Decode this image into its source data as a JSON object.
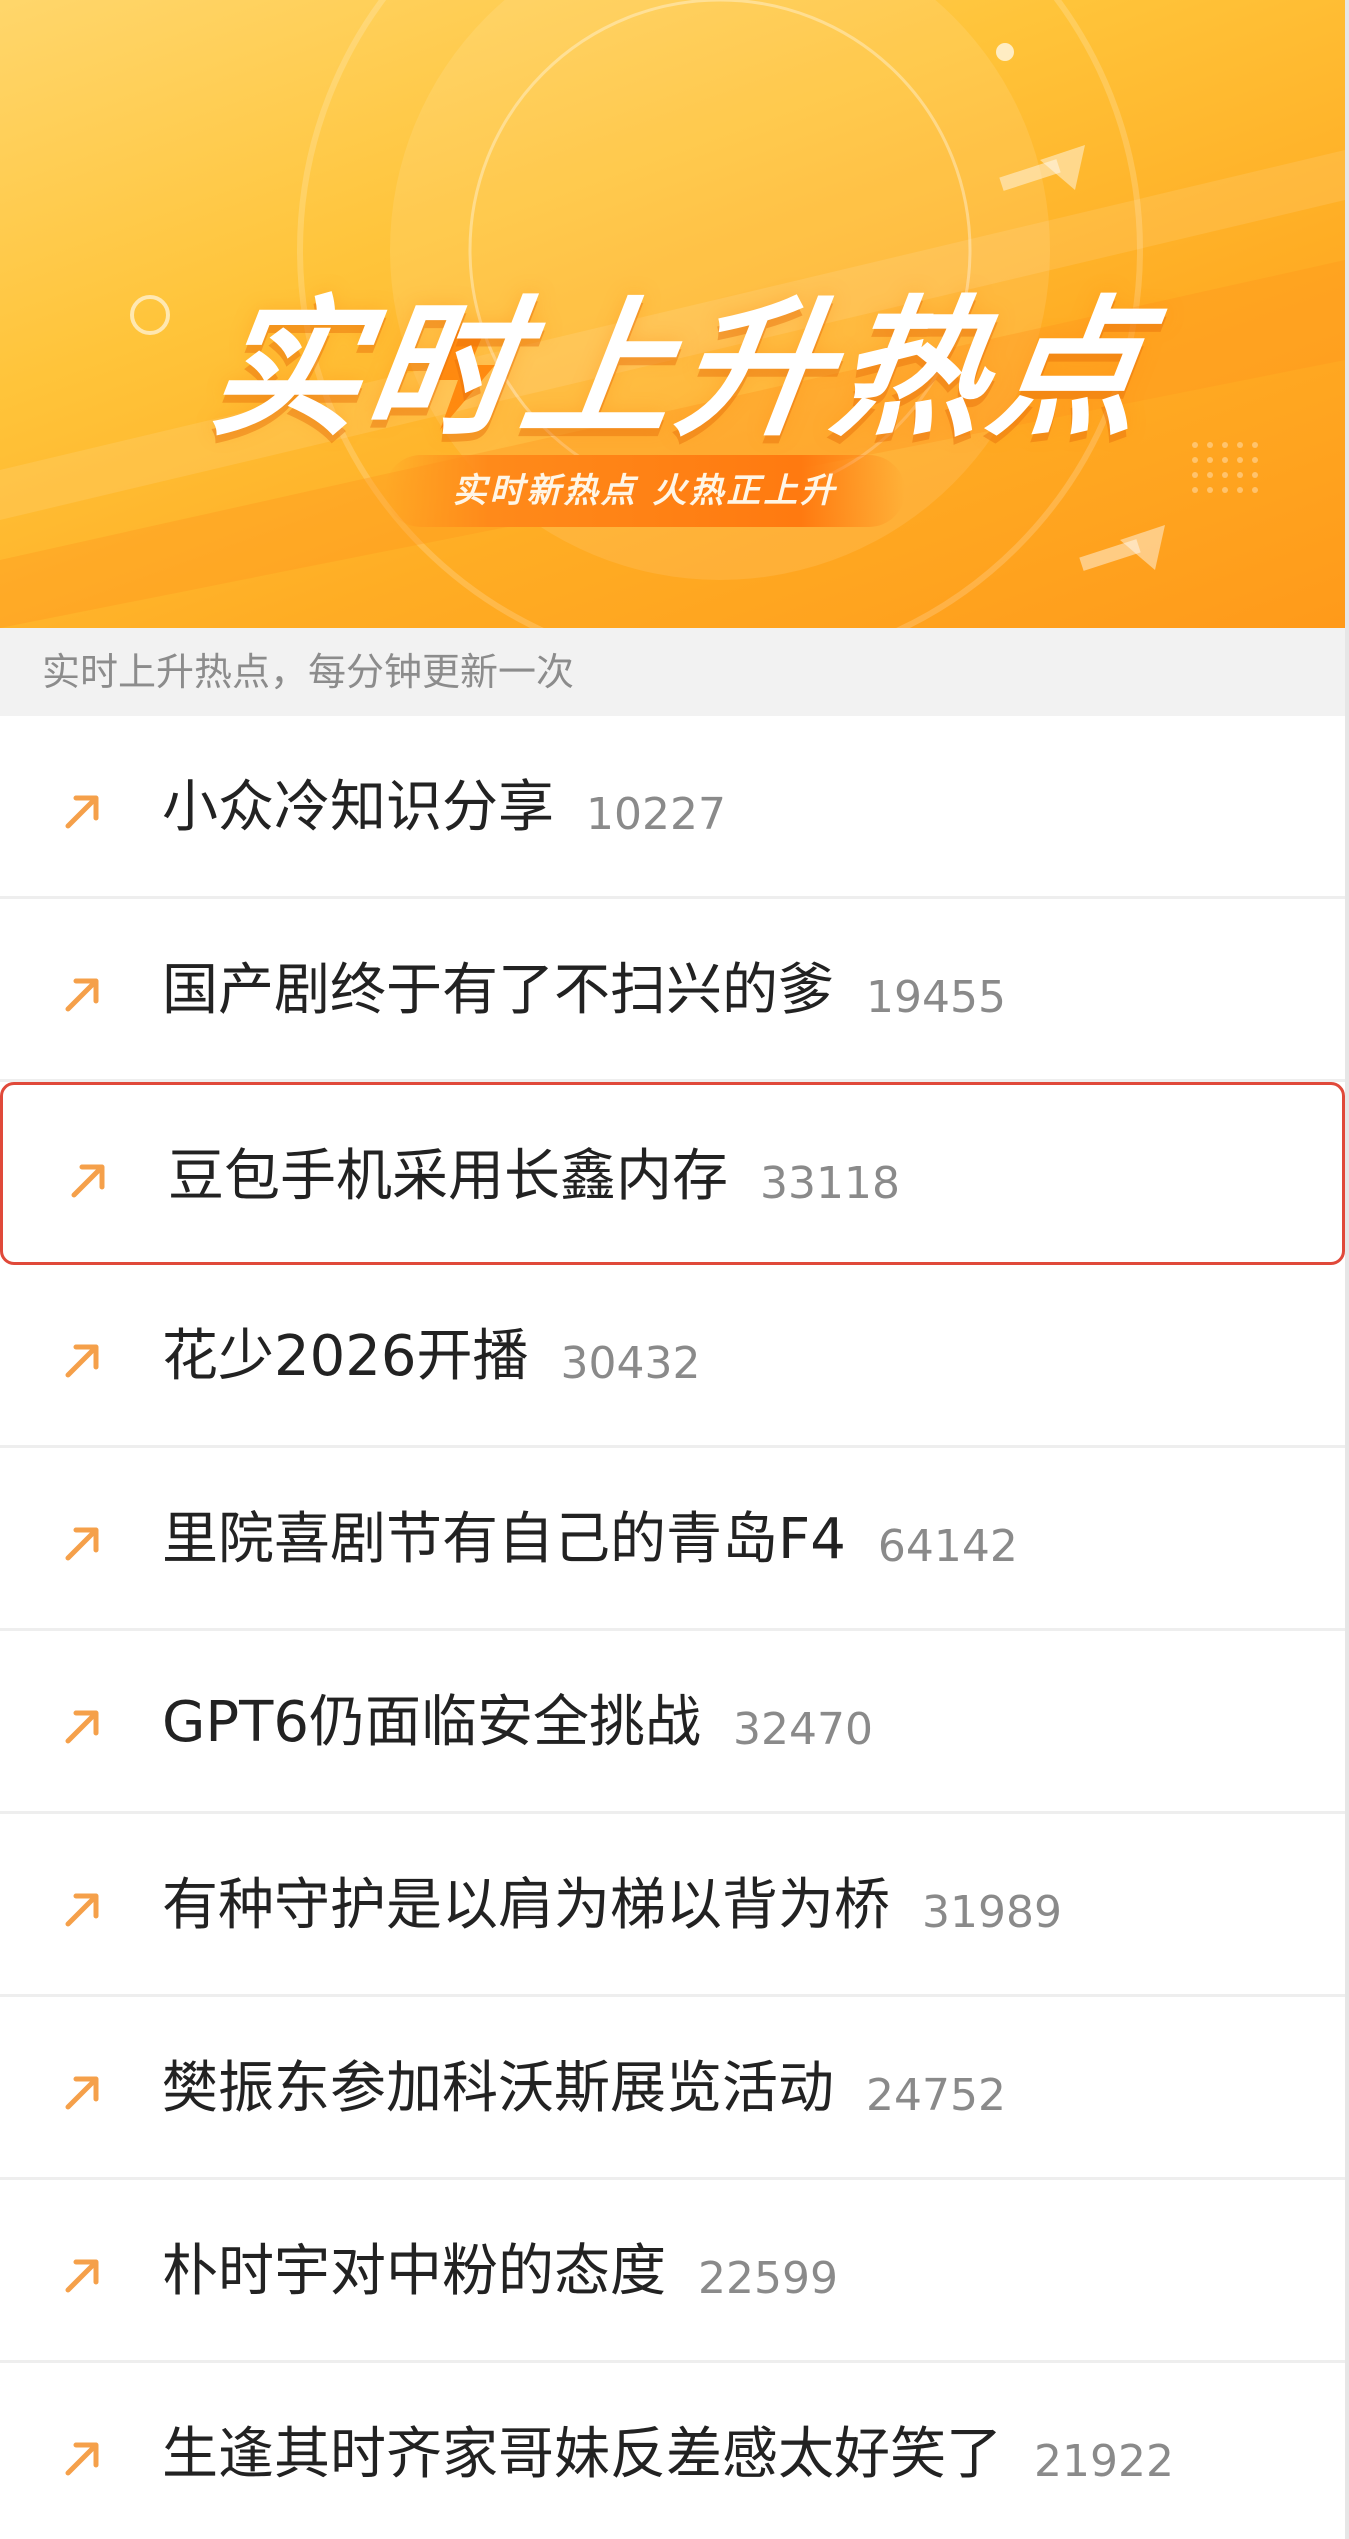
{
  "banner": {
    "title": "实时上升热点",
    "subtitle": "实时新热点 火热正上升"
  },
  "info": {
    "text": "实时上升热点，每分钟更新一次"
  },
  "colors": {
    "accent_orange": "#ff9a1a",
    "arrow": "#f5a04a",
    "highlight_border": "#e0493a"
  },
  "items": [
    {
      "title": "小众冷知识分享",
      "count": "10227",
      "icon": "trending-up-arrow-icon"
    },
    {
      "title": "国产剧终于有了不扫兴的爹",
      "count": "19455",
      "icon": "trending-up-arrow-icon"
    },
    {
      "title": "豆包手机采用长鑫内存",
      "count": "33118",
      "icon": "trending-up-arrow-icon",
      "highlighted": true
    },
    {
      "title": "花少2026开播",
      "count": "30432",
      "icon": "trending-up-arrow-icon"
    },
    {
      "title": "里院喜剧节有自己的青岛F4",
      "count": "64142",
      "icon": "trending-up-arrow-icon"
    },
    {
      "title": "GPT6仍面临安全挑战",
      "count": "32470",
      "icon": "trending-up-arrow-icon"
    },
    {
      "title": "有种守护是以肩为梯以背为桥",
      "count": "31989",
      "icon": "trending-up-arrow-icon"
    },
    {
      "title": "樊振东参加科沃斯展览活动",
      "count": "24752",
      "icon": "trending-up-arrow-icon"
    },
    {
      "title": "朴时宇对中粉的态度",
      "count": "22599",
      "icon": "trending-up-arrow-icon"
    },
    {
      "title": "生逢其时齐家哥妹反差感太好笑了",
      "count": "21922",
      "icon": "trending-up-arrow-icon"
    }
  ]
}
